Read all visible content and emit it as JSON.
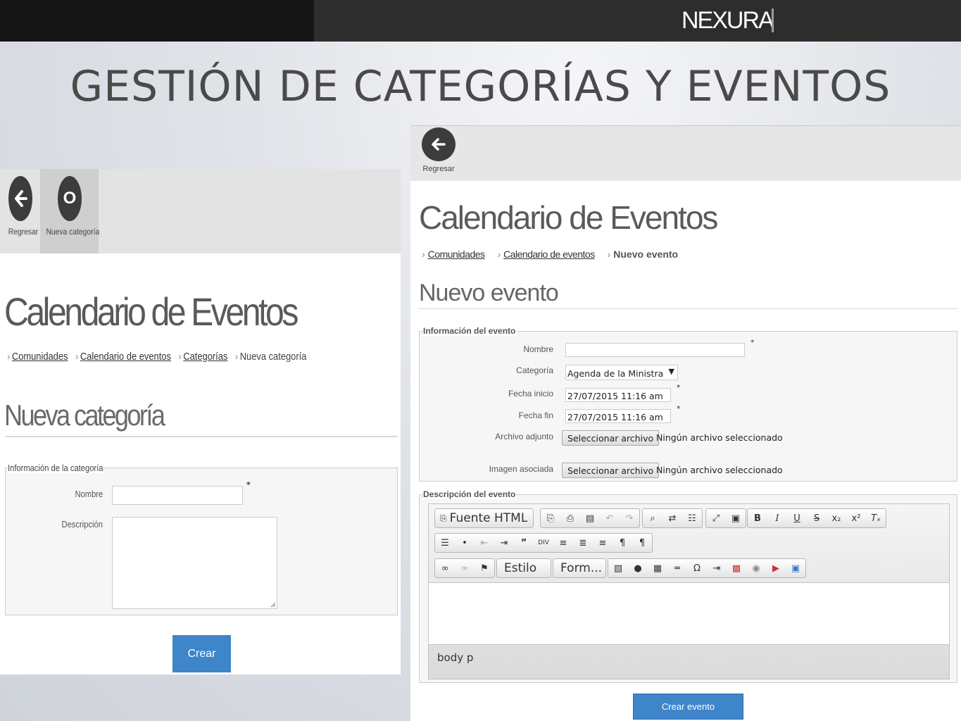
{
  "header": {
    "logo": "NEXURA",
    "slide_title": "GESTIÓN DE CATEGORÍAS Y EVENTOS"
  },
  "left": {
    "toolbar": {
      "back_label": "Regresar",
      "new_label": "Nueva categoría",
      "new_icon_text": "O"
    },
    "title": "Calendario de Eventos",
    "breadcrumb": [
      "Comunidades",
      "Calendario de eventos",
      "Categorías",
      "Nueva categoría"
    ],
    "subtitle": "Nueva categoría",
    "fieldset_legend": "Información de la categoría",
    "name_label": "Nombre",
    "name_required": "*",
    "description_label": "Descripción",
    "create_button": "Crear"
  },
  "right": {
    "toolbar": {
      "back_label": "Regresar"
    },
    "title": "Calendario de Eventos",
    "breadcrumb": [
      "Comunidades",
      "Calendario de eventos",
      "Nuevo evento"
    ],
    "subtitle": "Nuevo evento",
    "info_legend": "Información del evento",
    "fields": {
      "name_label": "Nombre",
      "category_label": "Categoría",
      "category_value": "Agenda de la Ministra",
      "start_label": "Fecha inicio",
      "start_value": "27/07/2015 11:16 am",
      "end_label": "Fecha fin",
      "end_value": "27/07/2015 11:16 am",
      "attachment_label": "Archivo adjunto",
      "image_label": "Imagen asociada",
      "file_button": "Seleccionar archivo",
      "no_file": "Ningún archivo seleccionado",
      "required": "*"
    },
    "desc_legend": "Descripción del evento",
    "editor": {
      "source_label": "Fuente HTML",
      "style_combo": "Estilo",
      "format_combo": "Form...",
      "status_path": "body  p"
    },
    "create_button": "Crear evento"
  }
}
